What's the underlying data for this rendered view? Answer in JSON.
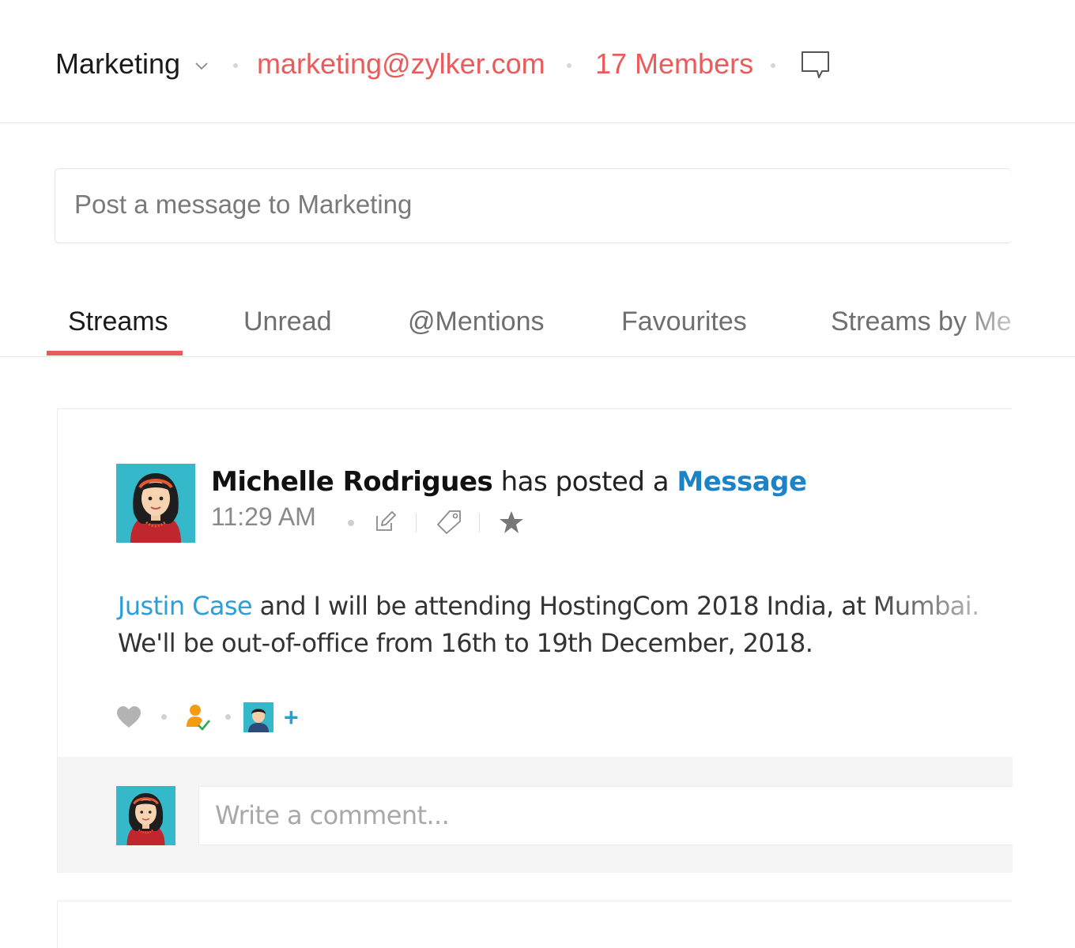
{
  "header": {
    "group_name": "Marketing",
    "group_email": "marketing@zylker.com",
    "members": "17 Members",
    "icons": [
      "chevron-down-icon",
      "chat-bubble-icon"
    ],
    "accent_color": "#ea5b5b"
  },
  "composer": {
    "placeholder": "Post a message to Marketing"
  },
  "tabs": [
    {
      "label": "Streams",
      "active": true
    },
    {
      "label": "Unread",
      "active": false
    },
    {
      "label": "@Mentions",
      "active": false
    },
    {
      "label": "Favourites",
      "active": false
    },
    {
      "label": "Streams by Me",
      "active": false
    }
  ],
  "post": {
    "author": "Michelle Rodrigues",
    "action": "has posted a",
    "type_link": "Message",
    "time": "11:29 AM",
    "action_icons": [
      "edit-icon",
      "tag-icon",
      "star-icon"
    ],
    "body": {
      "mention": "Justin Case",
      "line1_rest": " and I will be attending HostingCom 2018 India, at Mumbai.",
      "line2": "We'll be out-of-office from 16th to 19th December, 2018."
    },
    "reaction_icons": [
      "heart-icon",
      "assign-user-icon",
      "user-avatar-icon",
      "plus-icon"
    ],
    "plus": "+",
    "link_color": "#1c84c6"
  },
  "comment": {
    "placeholder": "Write a comment..."
  }
}
